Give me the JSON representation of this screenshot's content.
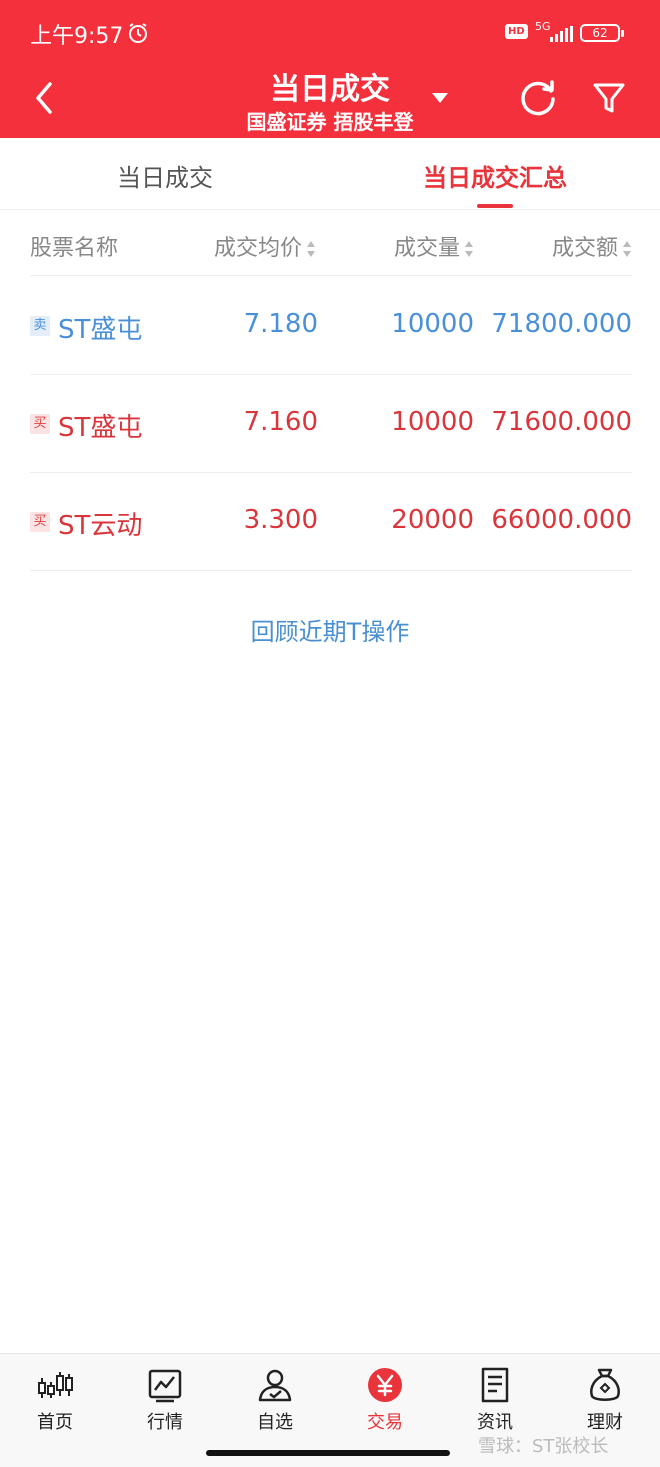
{
  "status_bar": {
    "time": "上午9:57",
    "hd": "HD",
    "network": "5G",
    "battery": "62"
  },
  "header": {
    "title": "当日成交",
    "subtitle": "国盛证券 捂股丰登"
  },
  "tabs": [
    {
      "label": "当日成交",
      "active": false
    },
    {
      "label": "当日成交汇总",
      "active": true
    }
  ],
  "table": {
    "columns": [
      "股票名称",
      "成交均价",
      "成交量",
      "成交额"
    ],
    "rows": [
      {
        "side": "卖",
        "name": "ST盛屯",
        "price": "7.180",
        "volume": "10000",
        "amount": "71800.000"
      },
      {
        "side": "买",
        "name": "ST盛屯",
        "price": "7.160",
        "volume": "10000",
        "amount": "71600.000"
      },
      {
        "side": "买",
        "name": "ST云动",
        "price": "3.300",
        "volume": "20000",
        "amount": "66000.000"
      }
    ]
  },
  "review_link": "回顾近期T操作",
  "bottom_nav": [
    {
      "label": "首页",
      "icon": "candlestick-icon"
    },
    {
      "label": "行情",
      "icon": "chart-icon"
    },
    {
      "label": "自选",
      "icon": "user-icon"
    },
    {
      "label": "交易",
      "icon": "yen-icon",
      "active": true
    },
    {
      "label": "资讯",
      "icon": "document-icon"
    },
    {
      "label": "理财",
      "icon": "money-bag-icon"
    }
  ],
  "watermark": "雪球：ST张校长",
  "colors": {
    "brand_red": "#f3303c",
    "sell_blue": "#4a90d9",
    "buy_red": "#d9353b"
  }
}
